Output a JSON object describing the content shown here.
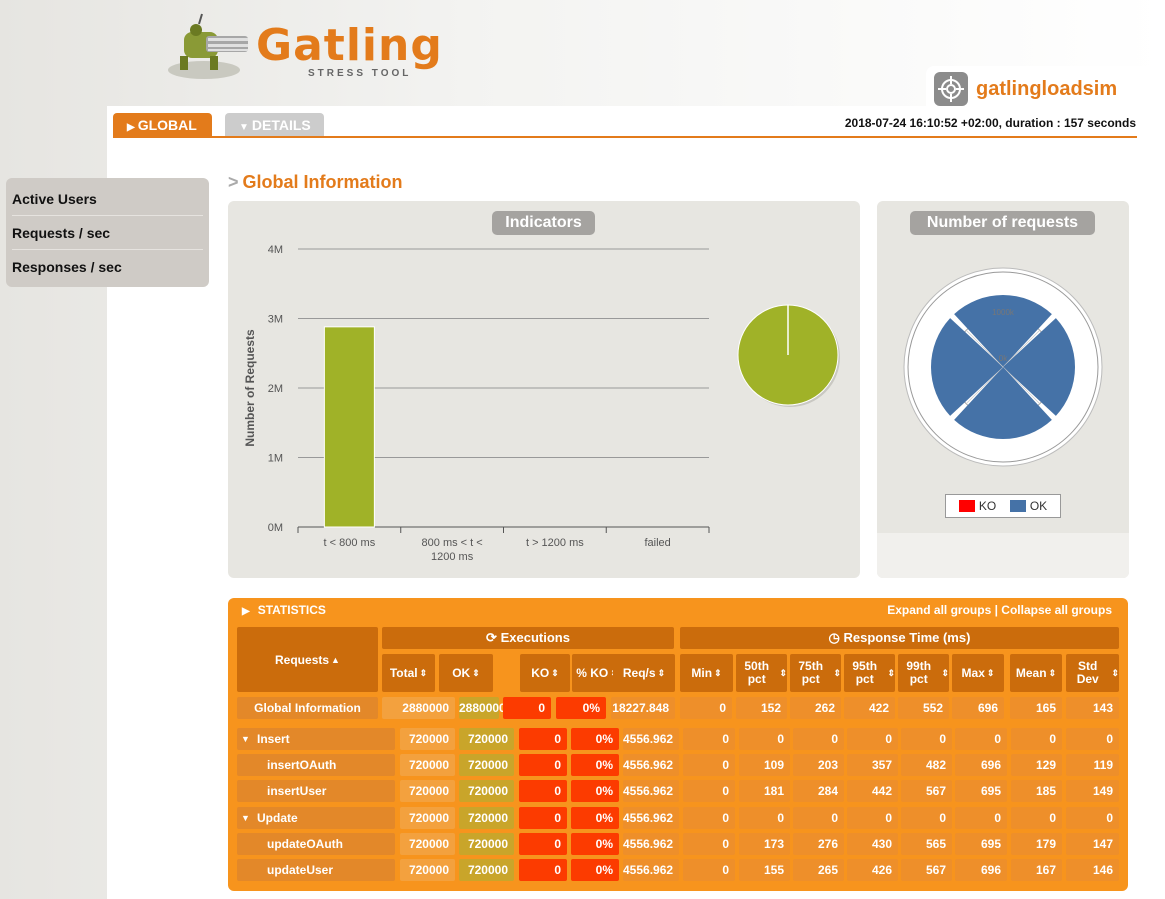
{
  "app": {
    "logo_word": "Gatling",
    "logo_sub": "STRESS TOOL",
    "simulation_name": "gatlingloadsim",
    "run_info": "2018-07-24 16:10:52 +02:00, duration : 157 seconds"
  },
  "tabs": [
    {
      "label": "GLOBAL",
      "active": true
    },
    {
      "label": "DETAILS",
      "active": false
    }
  ],
  "sidebar": {
    "items": [
      {
        "label": "Active Users"
      },
      {
        "label": "Requests / sec"
      },
      {
        "label": "Responses / sec"
      }
    ]
  },
  "section_title": "Global Information",
  "indicators": {
    "title": "Indicators",
    "chart_data": {
      "type": "bar",
      "categories": [
        "t < 800 ms",
        "800 ms < t < 1200 ms",
        "t > 1200 ms",
        "failed"
      ],
      "values": [
        2880000,
        0,
        0,
        0
      ],
      "ylabel": "Number of Requests",
      "yticks": [
        "0M",
        "1M",
        "2M",
        "3M",
        "4M"
      ],
      "ylim": [
        0,
        4000000
      ],
      "colors": [
        "#a0b228",
        "#ffdd00",
        "#ff9d00",
        "#ff0000"
      ],
      "pie": {
        "values": [
          2880000,
          0,
          0,
          0
        ]
      }
    }
  },
  "requests_chart": {
    "title": "Number of requests",
    "chart_data": {
      "type": "polar",
      "categories": [
        "insertOAuth",
        "insertUser",
        "updateOAuth",
        "updateUser"
      ],
      "series": [
        {
          "name": "KO",
          "values": [
            0,
            0,
            0,
            0
          ],
          "color": "#ff0000"
        },
        {
          "name": "OK",
          "values": [
            720000,
            720000,
            720000,
            720000
          ],
          "color": "#4572a7"
        }
      ],
      "ring_labels": [
        "1000k",
        "0k"
      ]
    }
  },
  "statistics": {
    "title": "STATISTICS",
    "expand_label": "Expand all groups",
    "separator": " | ",
    "collapse_label": "Collapse all groups",
    "requests_header": "Requests",
    "executions_header": "Executions",
    "response_time_header": "Response Time (ms)",
    "columns": [
      "Total",
      "OK",
      "KO",
      "% KO",
      "Req/s",
      "Min",
      "50th pct",
      "75th pct",
      "95th pct",
      "99th pct",
      "Max",
      "Mean",
      "Std Dev"
    ],
    "rows": [
      {
        "name": "Global Information",
        "kind": "global",
        "values": [
          "2880000",
          "2880000",
          "0",
          "0%",
          "18227.848",
          "0",
          "152",
          "262",
          "422",
          "552",
          "696",
          "165",
          "143"
        ]
      },
      {
        "name": "Insert",
        "kind": "group",
        "values": [
          "720000",
          "720000",
          "0",
          "0%",
          "4556.962",
          "0",
          "0",
          "0",
          "0",
          "0",
          "0",
          "0",
          "0"
        ]
      },
      {
        "name": "insertOAuth",
        "kind": "leaf",
        "values": [
          "720000",
          "720000",
          "0",
          "0%",
          "4556.962",
          "0",
          "109",
          "203",
          "357",
          "482",
          "696",
          "129",
          "119"
        ]
      },
      {
        "name": "insertUser",
        "kind": "leaf",
        "values": [
          "720000",
          "720000",
          "0",
          "0%",
          "4556.962",
          "0",
          "181",
          "284",
          "442",
          "567",
          "695",
          "185",
          "149"
        ]
      },
      {
        "name": "Update",
        "kind": "group",
        "values": [
          "720000",
          "720000",
          "0",
          "0%",
          "4556.962",
          "0",
          "0",
          "0",
          "0",
          "0",
          "0",
          "0",
          "0"
        ]
      },
      {
        "name": "updateOAuth",
        "kind": "leaf",
        "values": [
          "720000",
          "720000",
          "0",
          "0%",
          "4556.962",
          "0",
          "173",
          "276",
          "430",
          "565",
          "695",
          "179",
          "147"
        ]
      },
      {
        "name": "updateUser",
        "kind": "leaf",
        "values": [
          "720000",
          "720000",
          "0",
          "0%",
          "4556.962",
          "0",
          "155",
          "265",
          "426",
          "567",
          "696",
          "167",
          "146"
        ]
      }
    ]
  }
}
